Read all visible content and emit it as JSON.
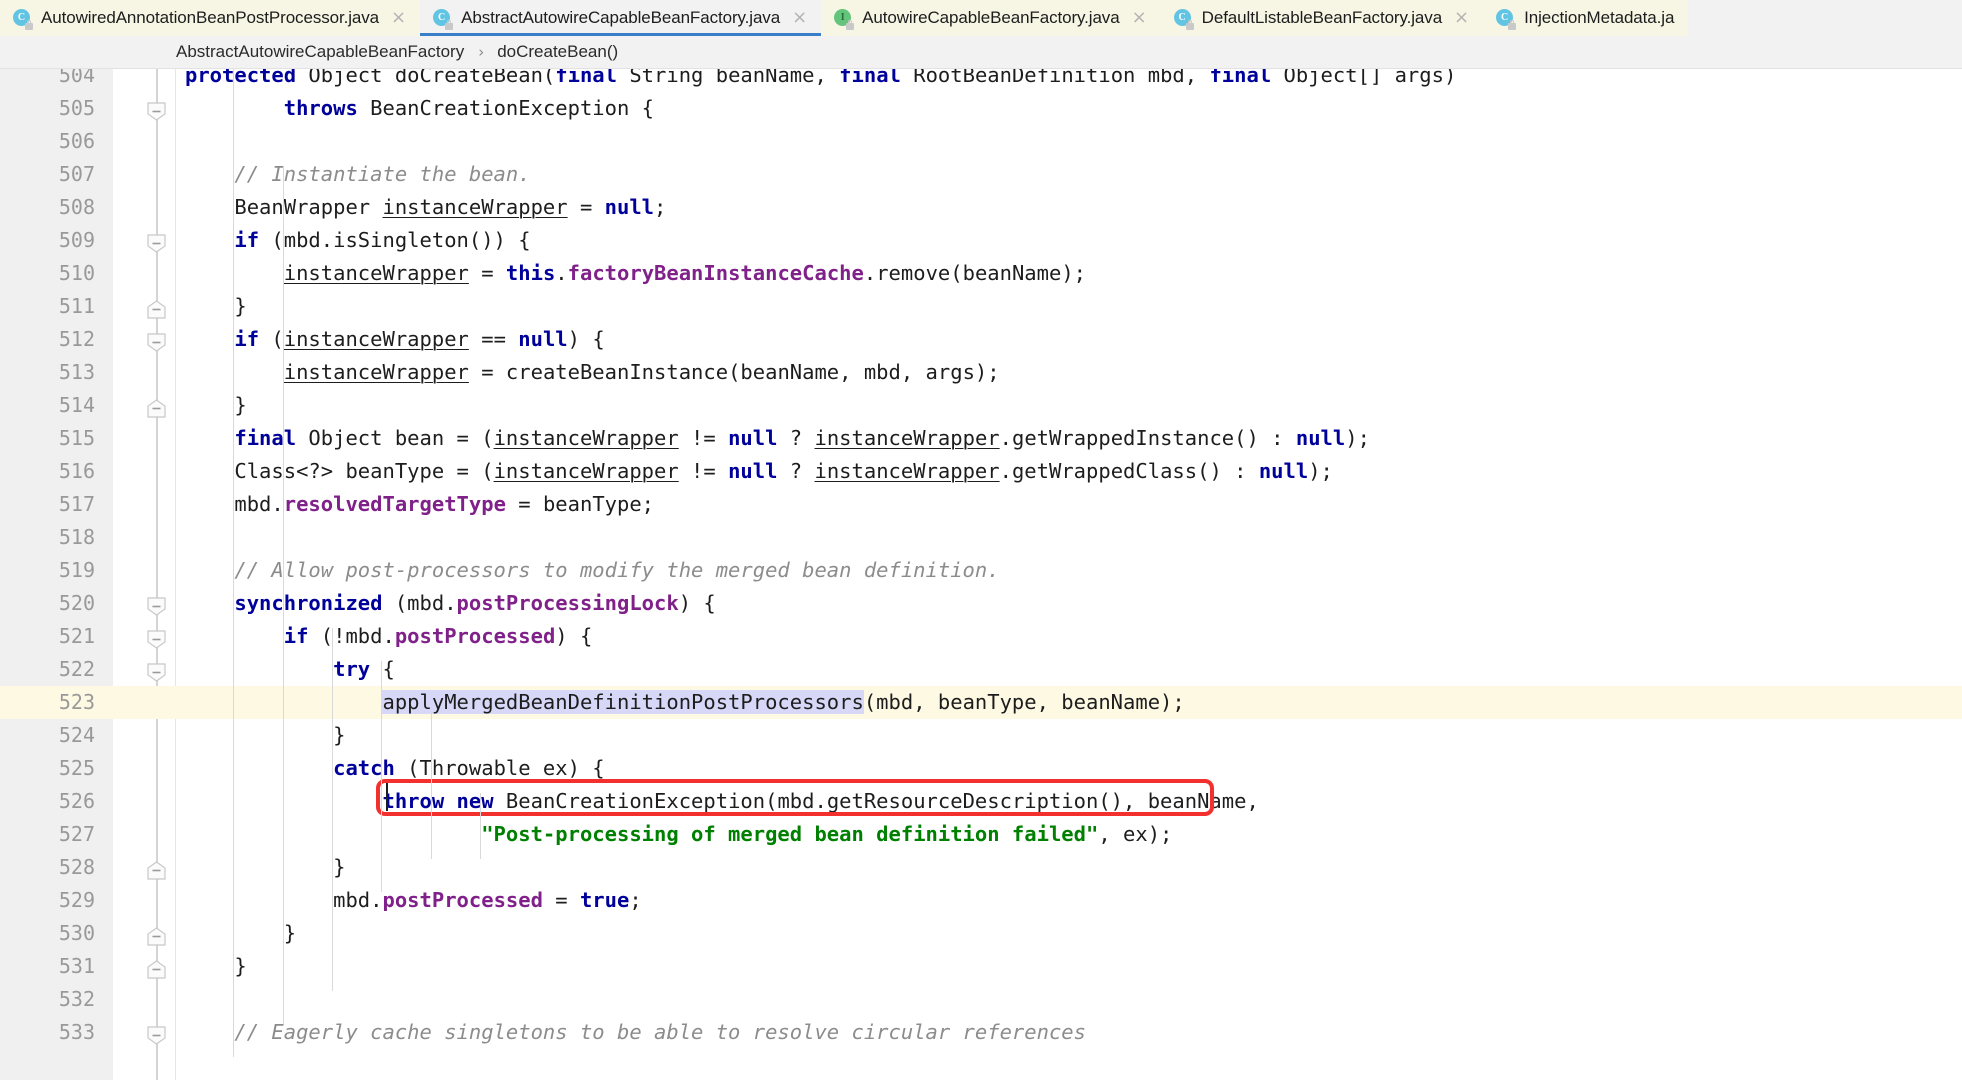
{
  "tabs": [
    {
      "label": "AutowiredAnnotationBeanPostProcessor.java",
      "icon": "java-class-icon",
      "kind": "cls",
      "letter": "C",
      "active": false,
      "close": "×"
    },
    {
      "label": "AbstractAutowireCapableBeanFactory.java",
      "icon": "java-class-icon",
      "kind": "cls",
      "letter": "C",
      "active": true,
      "close": "×"
    },
    {
      "label": "AutowireCapableBeanFactory.java",
      "icon": "java-interface-icon",
      "kind": "iface",
      "letter": "I",
      "active": false,
      "close": "×"
    },
    {
      "label": "DefaultListableBeanFactory.java",
      "icon": "java-class-icon",
      "kind": "cls",
      "letter": "C",
      "active": false,
      "close": "×"
    },
    {
      "label": "InjectionMetadata.ja",
      "icon": "java-class-icon",
      "kind": "cls",
      "letter": "C",
      "active": false,
      "close": ""
    }
  ],
  "breadcrumb": {
    "class": "AbstractAutowireCapableBeanFactory",
    "separator": "›",
    "method": "doCreateBean()"
  },
  "editor": {
    "first_line": 504,
    "caret_line": 523,
    "selection_text": "applyMergedBeanDefinitionPostProcessors",
    "annotation_color": "#f2302e",
    "caret_line_color": "#fdf9e3",
    "selection_color": "#d7d7f7",
    "lines": [
      {
        "n": 504,
        "text": "protected Object doCreateBean(final String beanName, final RootBeanDefinition mbd, final Object[] args)"
      },
      {
        "n": 505,
        "text": "        throws BeanCreationException {"
      },
      {
        "n": 506,
        "text": ""
      },
      {
        "n": 507,
        "text": "    // Instantiate the bean."
      },
      {
        "n": 508,
        "text": "    BeanWrapper instanceWrapper = null;"
      },
      {
        "n": 509,
        "text": "    if (mbd.isSingleton()) {"
      },
      {
        "n": 510,
        "text": "        instanceWrapper = this.factoryBeanInstanceCache.remove(beanName);"
      },
      {
        "n": 511,
        "text": "    }"
      },
      {
        "n": 512,
        "text": "    if (instanceWrapper == null) {"
      },
      {
        "n": 513,
        "text": "        instanceWrapper = createBeanInstance(beanName, mbd, args);"
      },
      {
        "n": 514,
        "text": "    }"
      },
      {
        "n": 515,
        "text": "    final Object bean = (instanceWrapper != null ? instanceWrapper.getWrappedInstance() : null);"
      },
      {
        "n": 516,
        "text": "    Class<?> beanType = (instanceWrapper != null ? instanceWrapper.getWrappedClass() : null);"
      },
      {
        "n": 517,
        "text": "    mbd.resolvedTargetType = beanType;"
      },
      {
        "n": 518,
        "text": ""
      },
      {
        "n": 519,
        "text": "    // Allow post-processors to modify the merged bean definition."
      },
      {
        "n": 520,
        "text": "    synchronized (mbd.postProcessingLock) {"
      },
      {
        "n": 521,
        "text": "        if (!mbd.postProcessed) {"
      },
      {
        "n": 522,
        "text": "            try {"
      },
      {
        "n": 523,
        "text": "                applyMergedBeanDefinitionPostProcessors(mbd, beanType, beanName);"
      },
      {
        "n": 524,
        "text": "            }"
      },
      {
        "n": 525,
        "text": "            catch (Throwable ex) {"
      },
      {
        "n": 526,
        "text": "                throw new BeanCreationException(mbd.getResourceDescription(), beanName,"
      },
      {
        "n": 527,
        "text": "                        \"Post-processing of merged bean definition failed\", ex);"
      },
      {
        "n": 528,
        "text": "            }"
      },
      {
        "n": 529,
        "text": "            mbd.postProcessed = true;"
      },
      {
        "n": 530,
        "text": "        }"
      },
      {
        "n": 531,
        "text": "    }"
      },
      {
        "n": 532,
        "text": ""
      },
      {
        "n": 533,
        "text": "    // Eagerly cache singletons to be able to resolve circular references"
      }
    ]
  }
}
